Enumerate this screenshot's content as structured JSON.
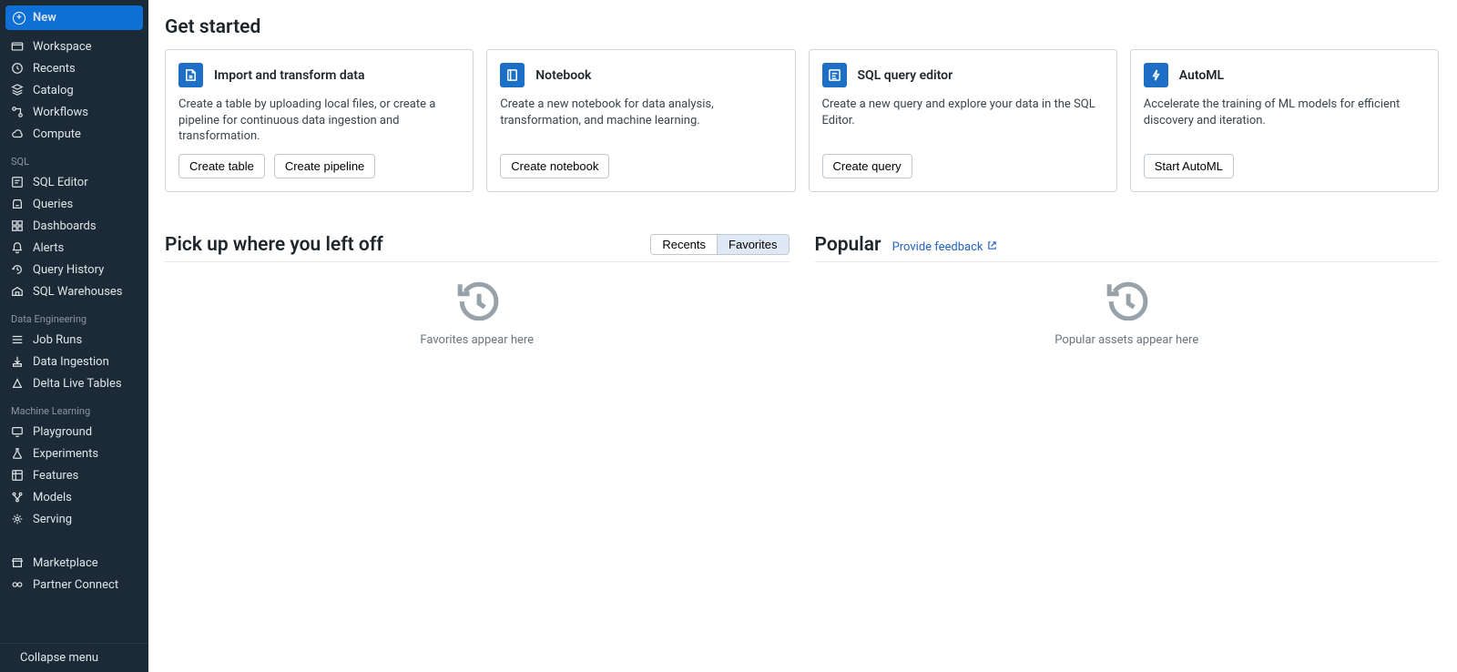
{
  "sidebar": {
    "new_label": "New",
    "collapse_label": "Collapse menu",
    "main_items": [
      {
        "label": "Workspace"
      },
      {
        "label": "Recents"
      },
      {
        "label": "Catalog"
      },
      {
        "label": "Workflows"
      },
      {
        "label": "Compute"
      }
    ],
    "sections": [
      {
        "title": "SQL",
        "items": [
          {
            "label": "SQL Editor"
          },
          {
            "label": "Queries"
          },
          {
            "label": "Dashboards"
          },
          {
            "label": "Alerts"
          },
          {
            "label": "Query History"
          },
          {
            "label": "SQL Warehouses"
          }
        ]
      },
      {
        "title": "Data Engineering",
        "items": [
          {
            "label": "Job Runs"
          },
          {
            "label": "Data Ingestion"
          },
          {
            "label": "Delta Live Tables"
          }
        ]
      },
      {
        "title": "Machine Learning",
        "items": [
          {
            "label": "Playground"
          },
          {
            "label": "Experiments"
          },
          {
            "label": "Features"
          },
          {
            "label": "Models"
          },
          {
            "label": "Serving"
          }
        ]
      }
    ],
    "bottom_items": [
      {
        "label": "Marketplace"
      },
      {
        "label": "Partner Connect"
      }
    ]
  },
  "get_started": {
    "heading": "Get started",
    "cards": [
      {
        "title": "Import and transform data",
        "desc": "Create a table by uploading local files, or create a pipeline for continuous data ingestion and transformation.",
        "buttons": [
          "Create table",
          "Create pipeline"
        ]
      },
      {
        "title": "Notebook",
        "desc": "Create a new notebook for data analysis, transformation, and machine learning.",
        "buttons": [
          "Create notebook"
        ]
      },
      {
        "title": "SQL query editor",
        "desc": "Create a new query and explore your data in the SQL Editor.",
        "buttons": [
          "Create query"
        ]
      },
      {
        "title": "AutoML",
        "desc": "Accelerate the training of ML models for efficient discovery and iteration.",
        "buttons": [
          "Start AutoML"
        ]
      }
    ]
  },
  "pickup": {
    "heading": "Pick up where you left off",
    "tabs": {
      "recents": "Recents",
      "favorites": "Favorites",
      "active": "favorites"
    },
    "empty": "Favorites appear here"
  },
  "popular": {
    "heading": "Popular",
    "feedback": "Provide feedback",
    "empty": "Popular assets appear here"
  }
}
